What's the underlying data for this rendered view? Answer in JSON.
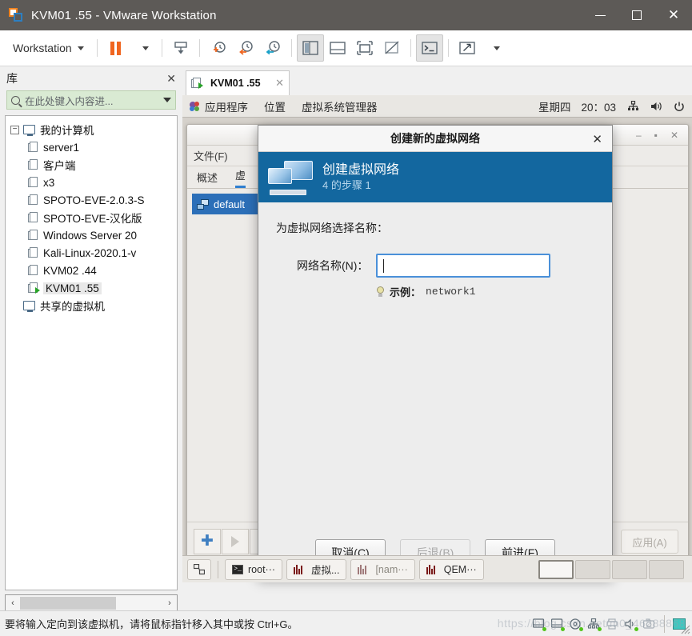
{
  "window": {
    "title": "KVM01 .55 - VMware Workstation",
    "icon": "vmware-logo-icon",
    "controls": {
      "minimize": "—",
      "maximize": "□",
      "close": "✕"
    }
  },
  "toolbar": {
    "workstation_label": "Workstation",
    "items": [
      {
        "name": "pause-button",
        "label": ""
      },
      {
        "name": "send-ctrl-alt-del-button",
        "label": ""
      },
      {
        "name": "take-snapshot-button",
        "label": ""
      },
      {
        "name": "revert-snapshot-button",
        "label": ""
      },
      {
        "name": "manage-snapshots-button",
        "label": ""
      },
      {
        "name": "show-library-button",
        "label": ""
      },
      {
        "name": "show-thumbnail-bar-button",
        "label": ""
      },
      {
        "name": "full-screen-button",
        "label": ""
      },
      {
        "name": "unity-mode-button",
        "label": ""
      },
      {
        "name": "console-view-button",
        "label": ""
      },
      {
        "name": "stretch-guest-button",
        "label": ""
      }
    ]
  },
  "library": {
    "title": "库",
    "close_label": "✕",
    "search_placeholder": "在此处键入内容进...",
    "root": {
      "label": "我的计算机",
      "expander": "−"
    },
    "vms": [
      {
        "label": "server1",
        "running": false,
        "selected": false
      },
      {
        "label": "客户端",
        "running": false,
        "selected": false
      },
      {
        "label": "x3",
        "running": false,
        "selected": false
      },
      {
        "label": "SPOTO-EVE-2.0.3-S",
        "running": false,
        "selected": false
      },
      {
        "label": "SPOTO-EVE-汉化版",
        "running": false,
        "selected": false
      },
      {
        "label": "Windows Server 20",
        "running": false,
        "selected": false
      },
      {
        "label": "Kali-Linux-2020.1-v",
        "running": false,
        "selected": false
      },
      {
        "label": "KVM02 .44",
        "running": false,
        "selected": false
      },
      {
        "label": "KVM01 .55",
        "running": true,
        "selected": true
      }
    ],
    "shared": "共享的虚拟机",
    "scroll": {
      "left": "‹",
      "right": "›"
    }
  },
  "vm_tab": {
    "label": "KVM01 .55",
    "close": "✕"
  },
  "guest": {
    "panel": {
      "applications": "应用程序",
      "places": "位置",
      "vmm": "虚拟系统管理器",
      "day": "星期四",
      "time": "20：03",
      "tray": [
        "network-icon",
        "volume-icon",
        "power-icon"
      ]
    },
    "virt_manager": {
      "menu": "文件(F)",
      "tabs": [
        {
          "label": "概述",
          "active": false
        },
        {
          "label": "虚",
          "active": true
        }
      ],
      "list": [
        {
          "label": "default",
          "selected": true
        }
      ],
      "footer_buttons": [
        "add-network-button",
        "start-network-button",
        "stop-network-button"
      ],
      "apply_label": "应用(A)",
      "window_controls": {
        "minimize": "–",
        "maximize": "▪",
        "close": "✕"
      }
    },
    "taskbar": {
      "show_desktop": "show-desktop-button",
      "items": [
        {
          "label": "root···",
          "icon": "terminal-icon"
        },
        {
          "label": "虚拟...",
          "icon": "vmm-icon"
        },
        {
          "label": "[nam···",
          "icon": "vmm-icon"
        },
        {
          "label": "QEM···",
          "icon": "vmm-icon"
        }
      ],
      "workspaces": [
        {
          "active": true
        },
        {
          "active": false
        },
        {
          "active": false
        },
        {
          "active": false
        }
      ]
    }
  },
  "dialog": {
    "title": "创建新的虚拟网络",
    "close_label": "✕",
    "banner": {
      "heading": "创建虚拟网络",
      "subheading": "4 的步骤 1",
      "icon": "two-monitors-icon",
      "color": "#13679f"
    },
    "prompt": "为虚拟网络选择名称：",
    "field_label": "网络名称(N)：",
    "field_value": "",
    "hint_label": "示例：",
    "hint_value": "network1",
    "buttons": [
      {
        "name": "cancel-button",
        "label": "取消(C)",
        "disabled": false
      },
      {
        "name": "back-button",
        "label": "后退(B)",
        "disabled": true
      },
      {
        "name": "forward-button",
        "label": "前进(F)",
        "disabled": false
      }
    ]
  },
  "statusbar": {
    "message": "要将输入定向到该虚拟机，请将鼠标指针移入其中或按 Ctrl+G。",
    "devices": [
      "hard-disk-icon",
      "hard-disk-icon",
      "cd-dvd-icon",
      "network-adapter-icon",
      "printer-icon",
      "sound-card-icon",
      "camera-icon",
      "usb-icon"
    ],
    "watermark": "https://blog.csdn.net/m0_46288868"
  }
}
